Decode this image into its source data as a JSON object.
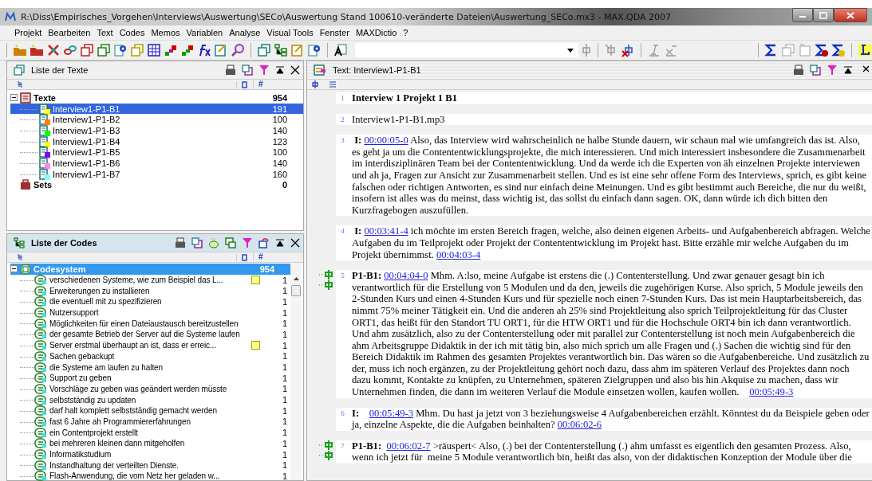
{
  "window": {
    "title": "R:\\Diss\\Empirisches_Vorgehen\\Interviews\\Auswertung\\SECo\\Auswertung Stand 100610-veränderte Dateien\\Auswertung_SECo.mx3 - MAX.QDA 2007"
  },
  "menu": [
    "Projekt",
    "Bearbeiten",
    "Text",
    "Codes",
    "Memos",
    "Variablen",
    "Analyse",
    "Visual Tools",
    "Fenster",
    "MAXDictio",
    "?"
  ],
  "texts_panel": {
    "title": "Liste der Texte",
    "count_header": "#",
    "root": {
      "label": "Texte",
      "count": "954",
      "expanded": true,
      "children": [
        {
          "label": "Interview1-P1-B1",
          "count": "191",
          "selected": true,
          "color": "#ffff00"
        },
        {
          "label": "Interview1-P1-B2",
          "count": "100",
          "selected": false,
          "color": "#ff8000"
        },
        {
          "label": "Interview1-P1-B3",
          "count": "140",
          "selected": false,
          "color": "#00ff00"
        },
        {
          "label": "Interview1-P1-B4",
          "count": "123",
          "selected": false,
          "color": "#ffff00"
        },
        {
          "label": "Interview1-P1-B5",
          "count": "100",
          "selected": false,
          "color": "#8000ff"
        },
        {
          "label": "Interview1-P1-B6",
          "count": "140",
          "selected": false,
          "color": "#ff80ff"
        },
        {
          "label": "Interview1-P1-B7",
          "count": "160",
          "selected": false,
          "color": "#80ffff"
        }
      ]
    },
    "sets": {
      "label": "Sets",
      "count": "0"
    }
  },
  "codes_panel": {
    "title": "Liste der Codes",
    "count_header": "#",
    "root": {
      "label": "Codesystem",
      "count": "954",
      "selected": true,
      "expanded": true,
      "children": [
        {
          "label": "verschiedenen Systeme, wie zum Beispiel das L...",
          "count": "1",
          "memo": true
        },
        {
          "label": "Erweiterungen zu installieren",
          "count": "1",
          "memo": false
        },
        {
          "label": "die eventuell mit zu spezifizieren",
          "count": "1",
          "memo": false
        },
        {
          "label": "Nutzersupport",
          "count": "1",
          "memo": false
        },
        {
          "label": "Möglichkeiten für einen Dateiaustausch bereitzustellen",
          "count": "1",
          "memo": false
        },
        {
          "label": "der gesamte Betrieb der Server auf die Systeme laufen",
          "count": "1",
          "memo": false
        },
        {
          "label": "Server erstmal überhaupt an ist, dass er erreic...",
          "count": "1",
          "memo": true
        },
        {
          "label": "Sachen gebackupt",
          "count": "1",
          "memo": false
        },
        {
          "label": "die Systeme am laufen zu halten",
          "count": "1",
          "memo": false
        },
        {
          "label": "Support zu geben",
          "count": "1",
          "memo": false
        },
        {
          "label": "Vorschläge zu geben was geändert werden müsste",
          "count": "1",
          "memo": false
        },
        {
          "label": "selbstständig zu updaten",
          "count": "1",
          "memo": false
        },
        {
          "label": "darf halt komplett selbstständig gemacht werden",
          "count": "1",
          "memo": false
        },
        {
          "label": "fast 6 Jahre ah Programmiererfahrungen",
          "count": "1",
          "memo": false
        },
        {
          "label": "ein Contentprojekt erstellt",
          "count": "1",
          "memo": false
        },
        {
          "label": "bei mehreren kleinen dann mitgeholfen",
          "count": "1",
          "memo": false
        },
        {
          "label": "Informatikstudium",
          "count": "1",
          "memo": false
        },
        {
          "label": "Instandhaltung der verteilten Dienste.",
          "count": "1",
          "memo": false
        },
        {
          "label": "Flash-Anwendung, die vom Netz her geladen w...",
          "count": "1",
          "memo": false
        }
      ]
    }
  },
  "document": {
    "title": "Text: Interview1-P1-B1",
    "paragraphs": [
      {
        "number": "1",
        "coded": false,
        "segments": [
          {
            "kind": "bold",
            "text": "Interview 1 Projekt 1 B1"
          }
        ]
      },
      {
        "number": "2",
        "coded": false,
        "segments": [
          {
            "kind": "text",
            "text": "Interview1-P1-B1.mp3"
          }
        ]
      },
      {
        "number": "3",
        "coded": false,
        "segments": [
          {
            "kind": "bold",
            "text": " I: "
          },
          {
            "kind": "link",
            "text": "00:00:05-0"
          },
          {
            "kind": "text",
            "text": " Also, das Interview wird wahrscheinlich ne halbe Stunde dauern, wir schaun mal wie umfangreich das ist. Also, es geht ja um die Contententwicklungsprojekte, die mich interessieren. Und mich interessiert insbesondere die Zusammenarbeit im interdisziplinären Team bei der Contententwicklung. Und da werde ich die Experten von äh einzelnen Projekte interviewen und ah ja, Fragen zur Ansicht zur Zusammenarbeit stellen. Und es ist eine sehr offene Form des Interviews, sprich, es gibt keine falschen oder richtigen Antworten, es sind nur einfach deine Meinungen. Und es gibt bestimmt auch Bereiche, die nur du weißt, insofern ist alles was du meinst, dass wichtig ist, das sollst du einfach dann sagen. OK, dann würde ich dich bitten den Kurzfragebogen auszufüllen."
          }
        ]
      },
      {
        "number": "4",
        "coded": false,
        "segments": [
          {
            "kind": "bold",
            "text": " I: "
          },
          {
            "kind": "link",
            "text": "00:03:41-4"
          },
          {
            "kind": "text",
            "text": " ich möchte im ersten Bereich fragen, welche, also deinen eigenen Arbeits- und Aufgabenbereich abfragen. Welche Aufgaben du im Teilprojekt oder Projekt der Contententwicklung im Projekt hast. Bitte erzähle mir welche Aufgaben du im Projekt übernimmst. "
          },
          {
            "kind": "link",
            "text": "00:04:03-4"
          }
        ]
      },
      {
        "number": "5",
        "coded": true,
        "segments": [
          {
            "kind": "bold",
            "text": "P1-B1: "
          },
          {
            "kind": "link",
            "text": "00:04:04-0"
          },
          {
            "kind": "text",
            "text": " Mhm. A:lso, meine Aufgabe ist erstens die (.) Contenterstellung. Und zwar genauer gesagt bin ich verantwortlich für die Erstellung von 5 Modulen und da den, jeweils die zugehörigen Kurse. Also sprich, 5 Module jeweils den 2-Stunden Kurs und einen 4-Stunden Kurs und für spezielle noch einen 7-Stunden Kurs. Das ist mein Hauptarbeitsbereich, das nimmt 75% meiner Tätigkeit ein. Und die anderen ah 25% sind Projektleitung also sprich Teilprojektleitung für das Cluster ORT1, das heißt für den Standort TU ORT1, für die HTW ORT1 und für die Hochschule ORT4 bin ich dann verantwortlich. Und ahm zusätzlich, also zu der Contenterstellung oder mit parallel zur Contenterstellung ist noch mein Aufgabenbereich die ahm Arbeitsgruppe Didaktik in der ich mit tätig bin, also mich sprich um alle Fragen und (.) Sachen die wichtig sind für den Bereich Didaktik im Rahmen des gesamten Projektes verantwortlich bin. Das wären so die Aufgabenbereiche. Und zusätzlich zu der, muss ich noch ergänzen, zu der Projektleitung gehört noch dazu, dass ahm im späteren Verlauf des Projektes dann noch dazu kommt, Kontakte zu knüpfen, zu Unternehmen, späteren Zielgruppen und also bis hin Akquise zu machen, dass wir Unternehmen finden, die dann im weiteren Verlauf die Module einsetzen wollen, kaufen wollen.    "
          },
          {
            "kind": "link",
            "text": "00:05:49-3"
          }
        ]
      },
      {
        "number": "6",
        "coded": false,
        "segments": [
          {
            "kind": "bold",
            "text": "I:    "
          },
          {
            "kind": "link",
            "text": "00:05:49-3"
          },
          {
            "kind": "text",
            "text": " Mhm. Du hast ja jetzt von 3 beziehungsweise 4 Aufgabenbereichen erzählt. Könntest du da Beispiele geben oder ja, einzelne Aspekte, die die Aufgaben beinhalten? "
          },
          {
            "kind": "link",
            "text": "00:06:02-6"
          }
        ]
      },
      {
        "number": "7",
        "coded": true,
        "segments": [
          {
            "kind": "bold",
            "text": "P1-B1:  "
          },
          {
            "kind": "link",
            "text": "00:06:02-7"
          },
          {
            "kind": "text",
            "text": " >räuspert< Also, (.) bei der Contenterstellung (.) ahm umfasst es eigentlich den gesamten Prozess. Also, wenn ich jetzt für  meine 5 Module verantwortlich bin, heißt das also, von der didaktischen Konzeption der Module über die"
          }
        ]
      }
    ]
  }
}
